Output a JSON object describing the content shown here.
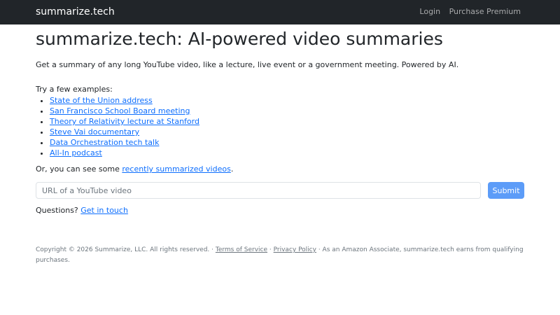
{
  "navbar": {
    "brand": "summarize.tech",
    "login": "Login",
    "premium": "Purchase Premium"
  },
  "main": {
    "title": "summarize.tech: AI-powered video summaries",
    "lead": "Get a summary of any long YouTube video, like a lecture, live event or a government meeting. Powered by AI.",
    "examples_label": "Try a few examples:",
    "examples": [
      "State of the Union address",
      "San Francisco School Board meeting",
      "Theory of Relativity lecture at Stanford",
      "Steve Vai documentary",
      "Data Orchestration tech talk",
      "All-In podcast"
    ],
    "recent_prefix": "Or, you can see some ",
    "recent_link": "recently summarized videos",
    "recent_suffix": ".",
    "url_placeholder": "URL of a YouTube video",
    "submit_label": "Submit",
    "questions_prefix": "Questions? ",
    "questions_link": "Get in touch"
  },
  "footer": {
    "copyright": "Copyright © 2026 Summarize, LLC. All rights reserved. · ",
    "terms": "Terms of Service",
    "sep": " · ",
    "privacy": "Privacy Policy",
    "amazon": " · As an Amazon Associate, summarize.tech earns from qualifying purchases."
  },
  "colors": {
    "navbar_bg": "#212529",
    "link": "#0d6efd",
    "submit_bg": "#5c9cf8"
  }
}
